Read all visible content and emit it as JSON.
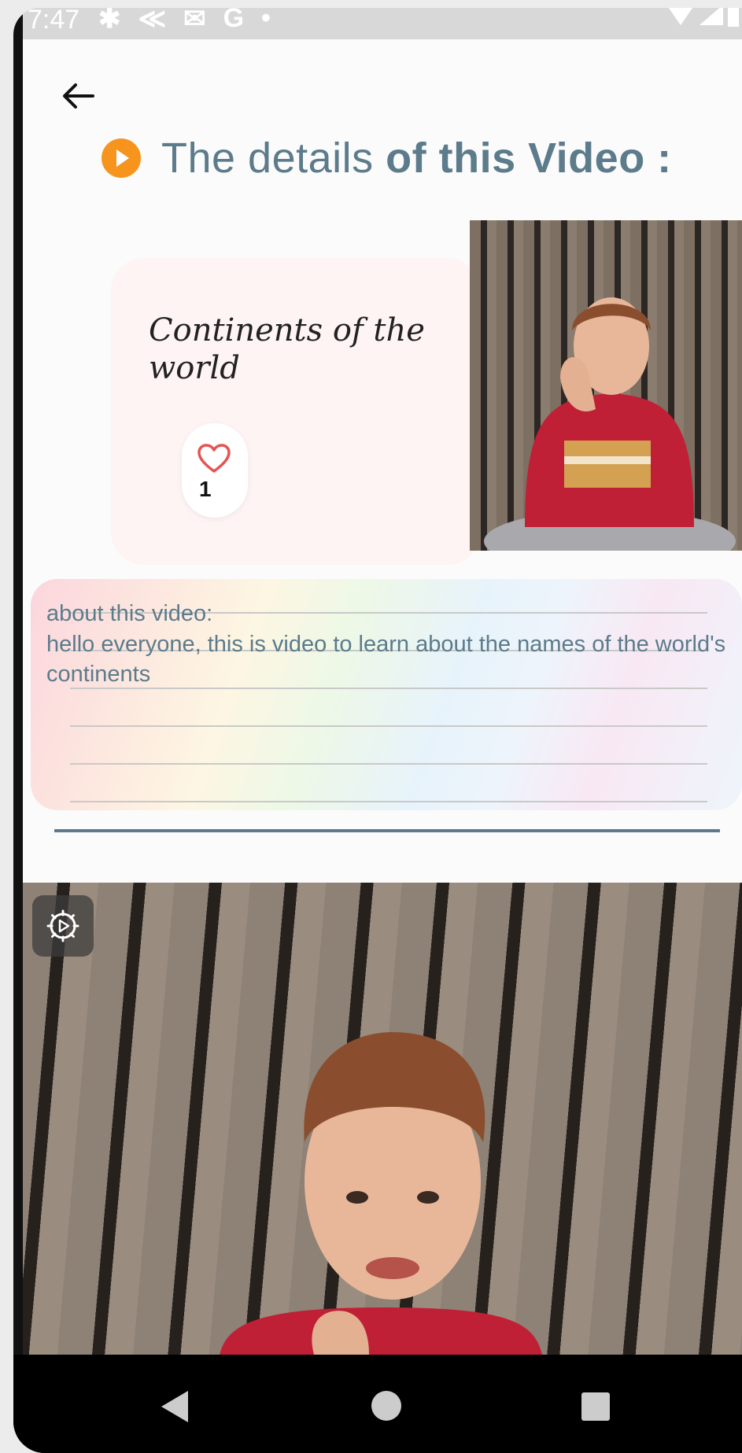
{
  "status_bar": {
    "time": "7:47",
    "icons": [
      "gear-icon",
      "bolt-icon",
      "mail-icon",
      "g-icon",
      "dot-icon"
    ]
  },
  "header": {
    "title_normal": "The details ",
    "title_bold": "of this Video :"
  },
  "video": {
    "name": "Continents of the world",
    "likes": "1"
  },
  "about": {
    "label": "about this video:",
    "text": "hello everyone, this is video to learn about the names of the world's continents"
  },
  "colors": {
    "accent": "#f7941d",
    "title": "#5c7b8b",
    "heart": "#e55353"
  }
}
